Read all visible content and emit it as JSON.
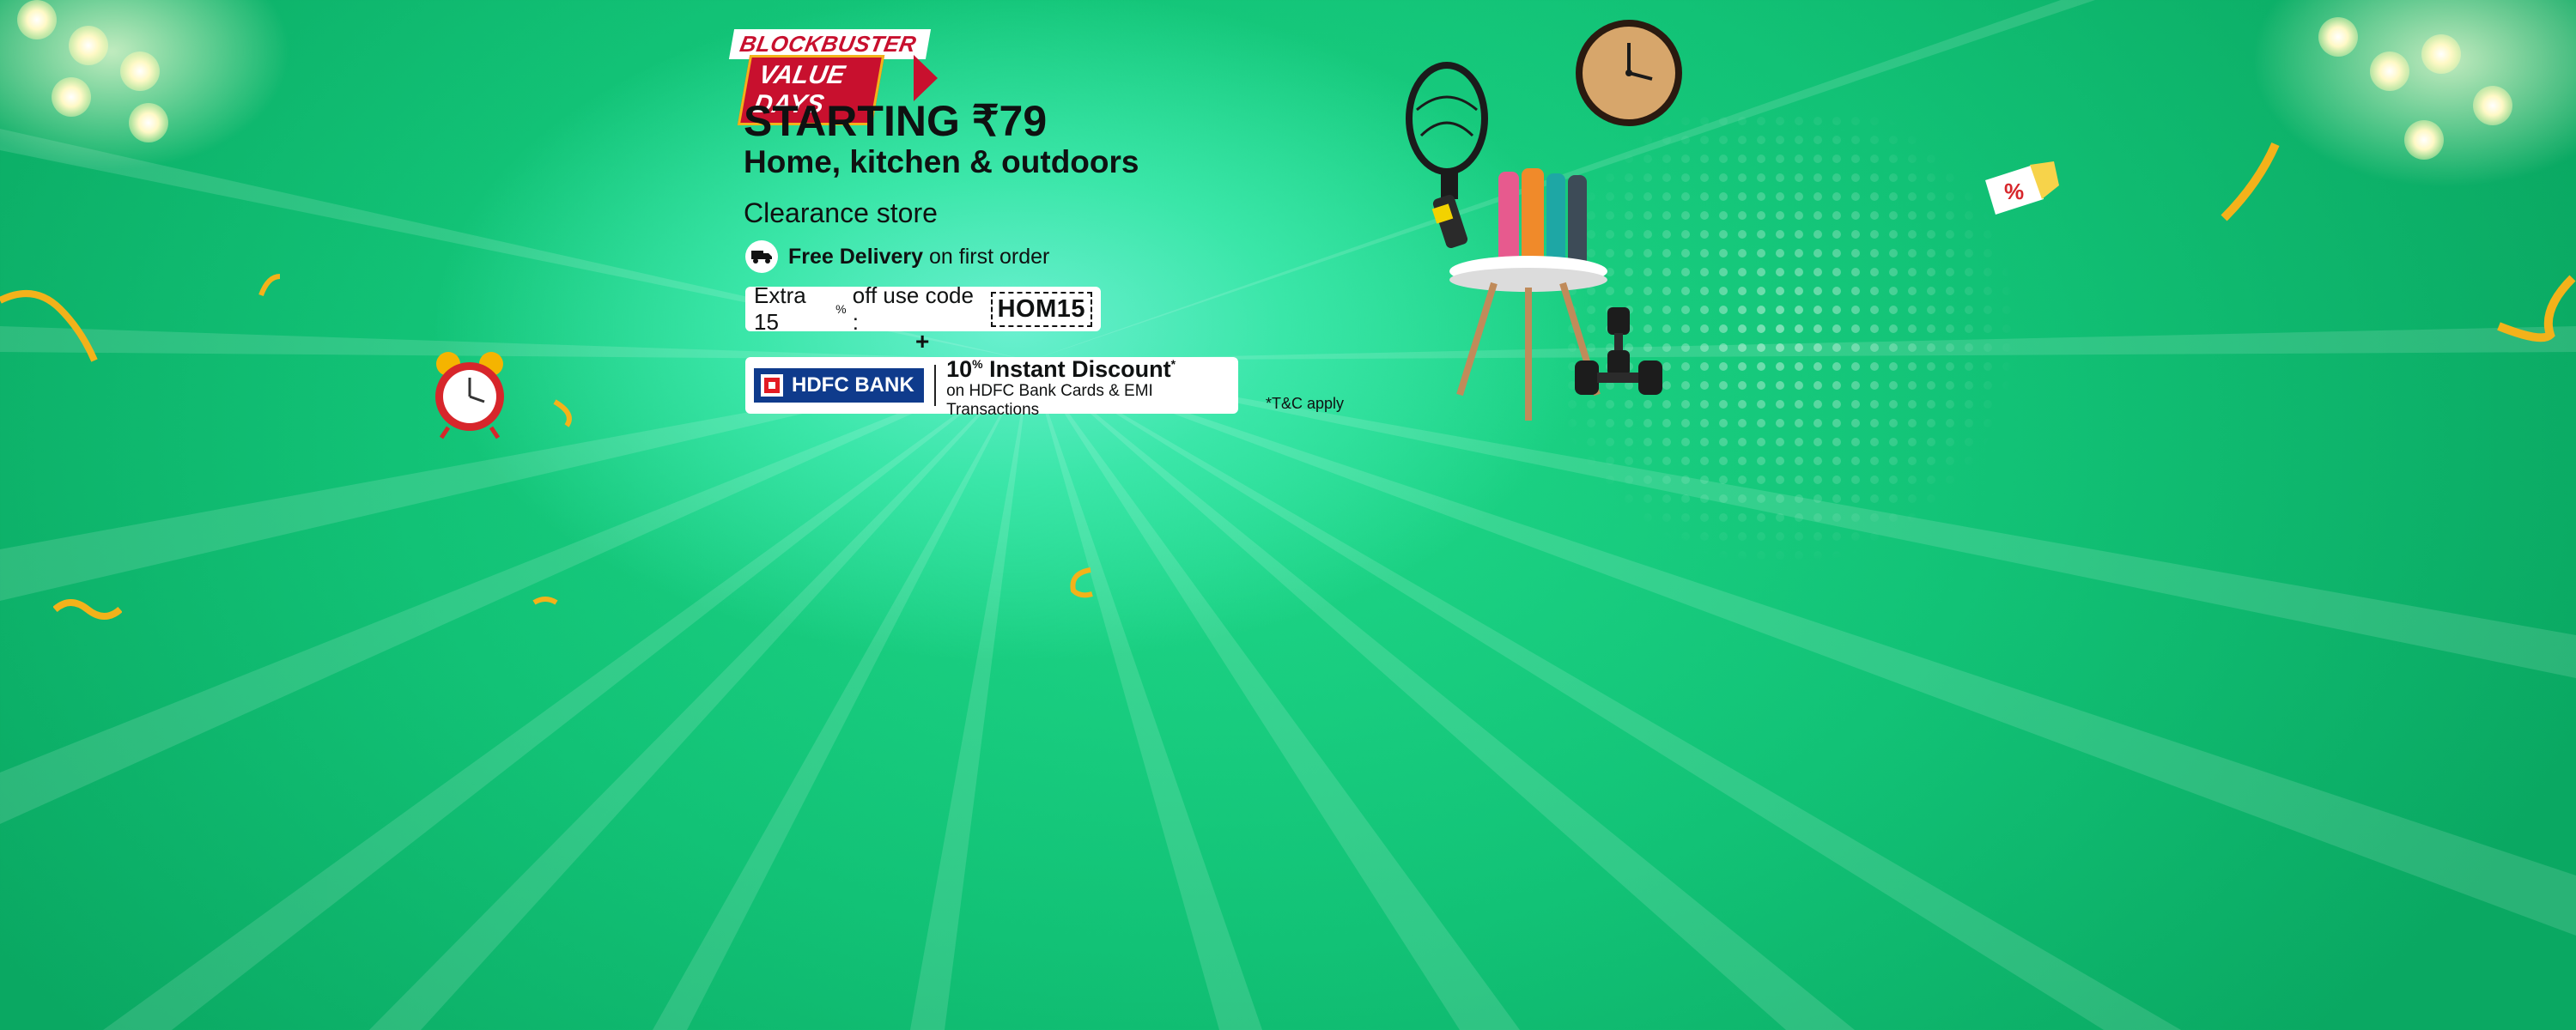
{
  "banner": {
    "badge_top": "BLOCKBUSTER",
    "badge_bottom": "VALUE DAYS"
  },
  "offer": {
    "starting": "STARTING ₹79",
    "subtitle": "Home, kitchen & outdoors",
    "store": "Clearance store"
  },
  "delivery": {
    "bold": "Free Delivery",
    "rest": "on first order",
    "icon": "truck-icon"
  },
  "coupon": {
    "prefix": "Extra 15",
    "percent": "%",
    "suffix": "off use code :",
    "code": "HOM15"
  },
  "plus": "+",
  "bank": {
    "name": "HDFC BANK",
    "discount": "10",
    "percent": "%",
    "discount_label": "Instant Discount",
    "asterisk": "*",
    "details": "on HDFC Bank Cards & EMI Transactions"
  },
  "tnc": "*T&C apply",
  "colors": {
    "background": "#12c276",
    "badge_red": "#c8102e",
    "hdfc_blue": "#0f3b8c"
  }
}
